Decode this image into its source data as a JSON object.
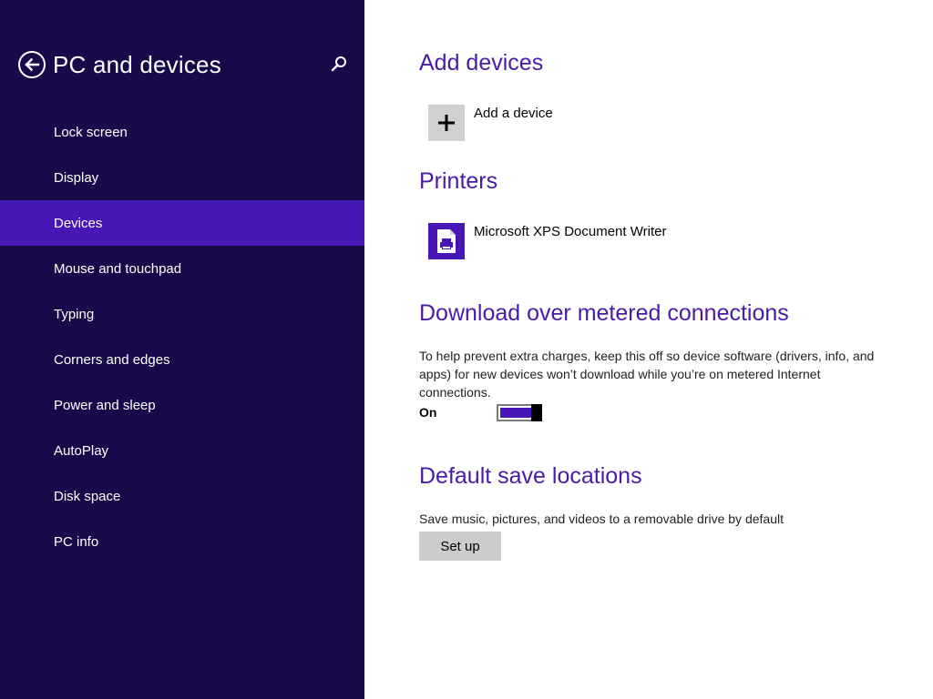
{
  "sidebar": {
    "back_icon": "back-arrow-circle-icon",
    "title": "PC and devices",
    "search_icon": "search-icon",
    "items": [
      {
        "label": "Lock screen"
      },
      {
        "label": "Display"
      },
      {
        "label": "Devices",
        "selected": true
      },
      {
        "label": "Mouse and touchpad"
      },
      {
        "label": "Typing"
      },
      {
        "label": "Corners and edges"
      },
      {
        "label": "Power and sleep"
      },
      {
        "label": "AutoPlay"
      },
      {
        "label": "Disk space"
      },
      {
        "label": "PC info"
      }
    ]
  },
  "main": {
    "add_devices": {
      "title": "Add devices",
      "add_label": "Add a device",
      "icon": "plus-icon"
    },
    "printers": {
      "title": "Printers",
      "items": [
        {
          "label": "Microsoft XPS Document Writer",
          "icon": "printer-icon"
        }
      ]
    },
    "metered": {
      "title": "Download over metered connections",
      "description": "To help prevent extra charges, keep this off so device software (drivers, info, and apps) for new devices won’t download while you’re on metered Internet connections.",
      "toggle_label": "On",
      "toggle_on": true
    },
    "save_locations": {
      "title": "Default save locations",
      "description": "Save music, pictures, and videos to a removable drive by default",
      "button_label": "Set up"
    }
  },
  "colors": {
    "sidebar_bg": "#180a4a",
    "selected_bg": "#4617b4",
    "accent": "#4a1aa8",
    "tile_gray": "#d0d0d0"
  }
}
